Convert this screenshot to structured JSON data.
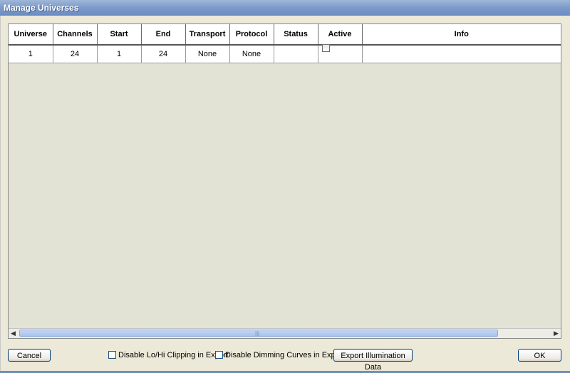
{
  "window": {
    "title": "Manage Universes"
  },
  "table": {
    "columns": [
      "Universe",
      "Channels",
      "Start",
      "End",
      "Transport",
      "Protocol",
      "Status",
      "Active",
      "Info"
    ],
    "rows": [
      {
        "universe": "1",
        "channels": "24",
        "start": "1",
        "end": "24",
        "transport": "None",
        "protocol": "None",
        "status": "",
        "active": false,
        "info": ""
      }
    ]
  },
  "scrollbar": {
    "grip": "|||"
  },
  "footer": {
    "cancel_label": "Cancel",
    "disable_clipping_label": "Disable Lo/Hi Clipping in Export",
    "disable_clipping_checked": false,
    "disable_dimming_label": "Disable Dimming Curves in Export",
    "disable_dimming_checked": false,
    "export_label": "Export Illumination Data",
    "ok_label": "OK"
  }
}
